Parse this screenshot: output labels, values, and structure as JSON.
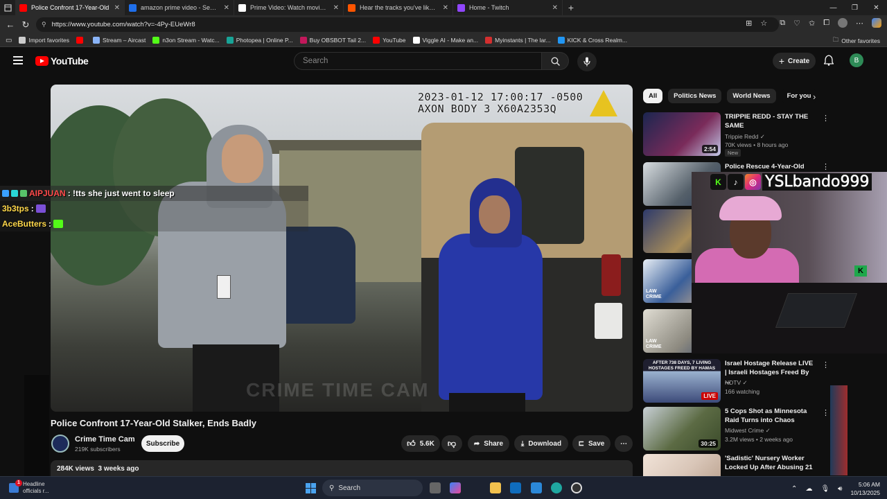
{
  "browser": {
    "tabs": [
      {
        "title": "Police Confront 17-Year-Old",
        "favicon_color": "#ff0000",
        "active": true
      },
      {
        "title": "amazon prime video - Search",
        "favicon_color": "#1f6feb",
        "active": false
      },
      {
        "title": "Prime Video: Watch movies, TV sh",
        "favicon_color": "#ffffff",
        "active": false
      },
      {
        "title": "Hear the tracks you've liked: on S",
        "favicon_color": "#ff5500",
        "active": false
      },
      {
        "title": "Home - Twitch",
        "favicon_color": "#9146ff",
        "active": false
      }
    ],
    "url": "https://www.youtube.com/watch?v=-4Py-EUeWr8",
    "bookmarks": [
      {
        "label": "Import favorites",
        "color": "#cccccc"
      },
      {
        "label": "",
        "color": "#ff0000"
      },
      {
        "label": "Stream – Aircast",
        "color": "#8ab4f8"
      },
      {
        "label": "n3on Stream - Watc...",
        "color": "#53fc18"
      },
      {
        "label": "Photopea | Online P...",
        "color": "#18a497"
      },
      {
        "label": "Buy OBSBOT Tail 2...",
        "color": "#c2185b"
      },
      {
        "label": "YouTube",
        "color": "#ff0000"
      },
      {
        "label": "Viggle AI - Make an...",
        "color": "#ffffff"
      },
      {
        "label": "Myinstants | The lar...",
        "color": "#d32f2f"
      },
      {
        "label": "KICK & Cross Realm...",
        "color": "#2196f3"
      }
    ],
    "other_favorites": "Other favorites"
  },
  "youtube": {
    "logo_text": "YouTube",
    "search_placeholder": "Search",
    "create_label": "Create",
    "avatar_letter": "B",
    "video": {
      "timestamp_line1": "2023-01-12 17:00:17 -0500",
      "timestamp_line2": "AXON BODY 3 X60A2353Q",
      "watermark": "CRIME TIME CAM",
      "title": "Police Confront 17-Year-Old Stalker, Ends Badly",
      "channel": "Crime Time Cam",
      "subscribers": "219K subscribers",
      "subscribe_label": "Subscribe",
      "likes": "5.6K",
      "share_label": "Share",
      "download_label": "Download",
      "save_label": "Save",
      "views": "284K views",
      "age": "3 weeks ago"
    },
    "chips": [
      "All",
      "Politics News",
      "World News",
      "For you"
    ],
    "recommendations": [
      {
        "title": "TRIPPIE REDD - STAY THE SAME",
        "channel": "Trippie Redd",
        "meta": "70K views • 8 hours ago",
        "duration": "2:54",
        "badge": "New",
        "thumb_color": "#1b2650"
      },
      {
        "title": "Police Rescue 4-Year-Old From",
        "channel": "",
        "meta": "",
        "duration": "",
        "badge": "",
        "thumb_color": "#6d7a80"
      },
      {
        "title": "",
        "channel": "",
        "meta": "",
        "duration": "",
        "badge": "",
        "thumb_color": "#2d3a6b"
      },
      {
        "title": "",
        "channel": "",
        "meta": "",
        "duration": "",
        "badge": "",
        "thumb_color": "#3a5f9a",
        "thumb_text": "LAW CRIME"
      },
      {
        "title": "",
        "channel": "",
        "meta": "",
        "duration": "",
        "badge": "",
        "thumb_color": "#c9c3b2",
        "thumb_text": "LAW CRIME"
      },
      {
        "title": "Israel Hostage Release LIVE | Israeli Hostages Freed By ...",
        "channel": "NDTV",
        "meta": "166 watching",
        "duration": "",
        "badge": "LIVE",
        "thumb_color": "#3d4b7a",
        "thumb_text": "AFTER 738 DAYS, 7 LIVING HOSTAGES FREED BY HAMAS"
      },
      {
        "title": "5 Cops Shot as Minnesota Raid Turns into Chaos",
        "channel": "Midwest Crime",
        "meta": "3.2M views • 2 weeks ago",
        "duration": "30:25",
        "badge": "",
        "thumb_color": "#5c6b44"
      },
      {
        "title": "'Sadistic' Nursery Worker Locked Up After Abusing 21 ...",
        "channel": "",
        "meta": "",
        "duration": "",
        "badge": "",
        "thumb_color": "#d9c6b8"
      }
    ]
  },
  "chat": [
    {
      "user": "AIPJUAN",
      "user_color": "#ff4b4b",
      "message": ": !tts she just went to sleep"
    },
    {
      "user": "3b3tps",
      "user_color": "#ffd84a",
      "message": ":"
    },
    {
      "user": "AceButters",
      "user_color": "#ffd84a",
      "message": ":"
    }
  ],
  "stream_overlay": {
    "name": "YSLbando999"
  },
  "taskbar": {
    "news_line1": "Headline",
    "news_line2": "officials r...",
    "search_placeholder": "Search",
    "time": "5:06 AM",
    "date": "10/13/2025",
    "news_badge": "1"
  }
}
